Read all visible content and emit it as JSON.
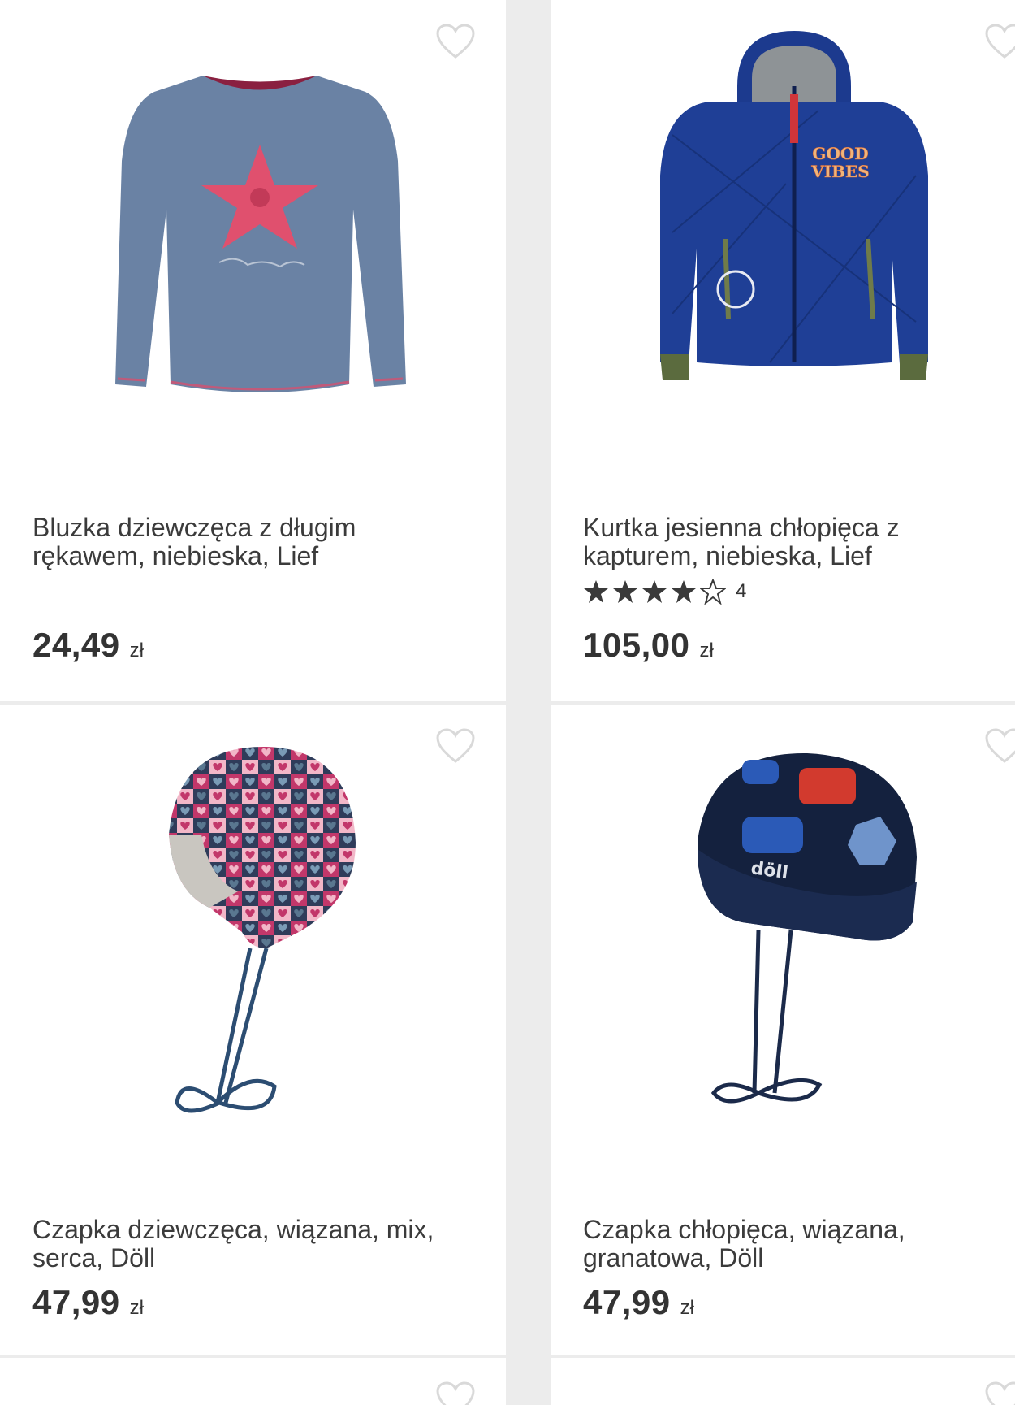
{
  "colors": {
    "background": "#ececec",
    "card": "#ffffff",
    "text": "#3b3b3b",
    "heart_outline": "#d9d9d9"
  },
  "products": [
    {
      "title": "Bluzka dziewczęca z długim rękawem, niebieska, Lief",
      "price": "24,49",
      "currency": "zł",
      "image_icon": "long-sleeve-shirt-snowflake"
    },
    {
      "title": "Kurtka jesienna chłopięca z kapturem, niebieska, Lief",
      "rating_stars": 4,
      "rating_max": 5,
      "rating_count": "4",
      "price": "105,00",
      "currency": "zł",
      "image_icon": "hooded-jacket"
    },
    {
      "title": "Czapka dziewczęca, wiązana, mix, serca, Döll",
      "price": "47,99",
      "currency": "zł",
      "image_icon": "knit-hat-hearts"
    },
    {
      "title": "Czapka chłopięca, wiązana, granatowa, Döll",
      "price": "47,99",
      "currency": "zł",
      "image_icon": "knit-hat-monsters",
      "image_text": "döll"
    }
  ],
  "jacket_patch": "GOOD VIBES"
}
